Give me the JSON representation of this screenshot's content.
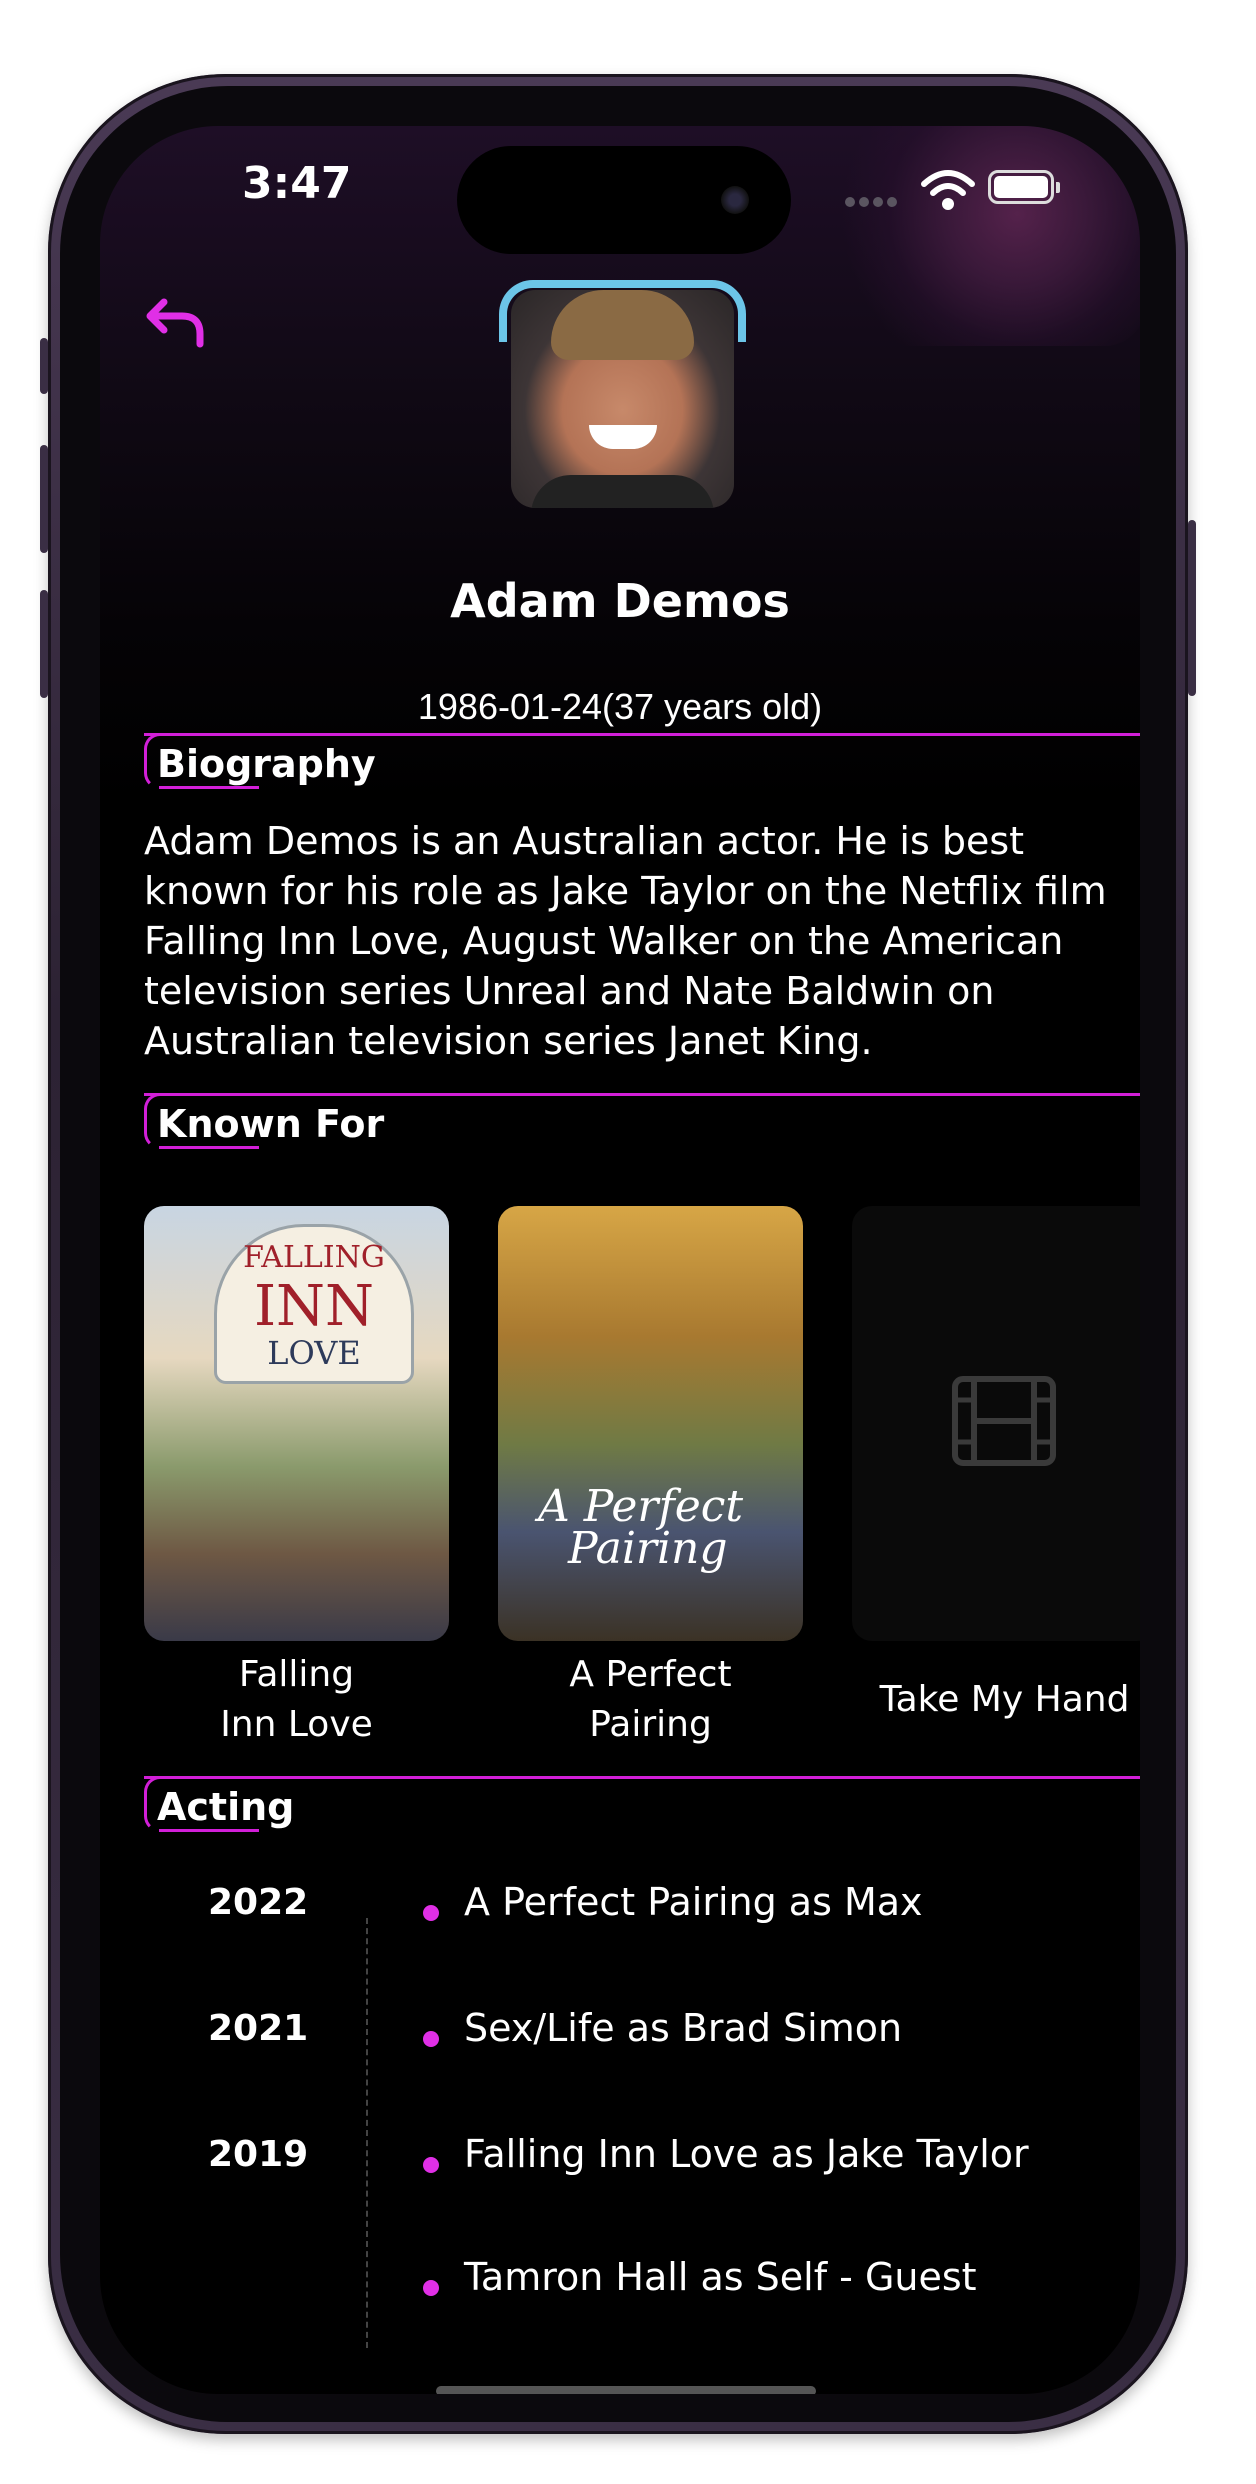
{
  "status_bar": {
    "time": "3:47"
  },
  "actor": {
    "name": "Adam Demos",
    "birth": "1986-01-24(37 years old)"
  },
  "sections": {
    "biography": "Biography",
    "known_for": "Known For",
    "acting": "Acting"
  },
  "biography_text": "Adam Demos is an Australian actor. He is best known for his role as Jake Taylor on the Netflix film Falling Inn Love, August Walker on the American television series Unreal and Nate Baldwin on Australian television series Janet King.",
  "known_for": [
    {
      "title_line1": "Falling",
      "title_line2": "Inn Love",
      "poster_text": [
        "FALLING",
        "INN",
        "LOVE"
      ]
    },
    {
      "title_line1": "A Perfect",
      "title_line2": "Pairing",
      "poster_text": [
        "A Perfect",
        "Pairing"
      ]
    },
    {
      "title": "Take My Hand",
      "poster_icon": "film-icon"
    }
  ],
  "acting": [
    {
      "year": "2022",
      "role": "A Perfect Pairing as Max"
    },
    {
      "year": "2021",
      "role": "Sex/Life as Brad Simon"
    },
    {
      "year": "2019",
      "role": "Falling Inn Love as Jake Taylor"
    },
    {
      "year": "",
      "role": "Tamron Hall as Self - Guest"
    }
  ],
  "colors": {
    "accent": "#d21fd8",
    "dot": "#e02fe6",
    "avatar_frame": "#6cc5e8",
    "background": "#000000"
  }
}
